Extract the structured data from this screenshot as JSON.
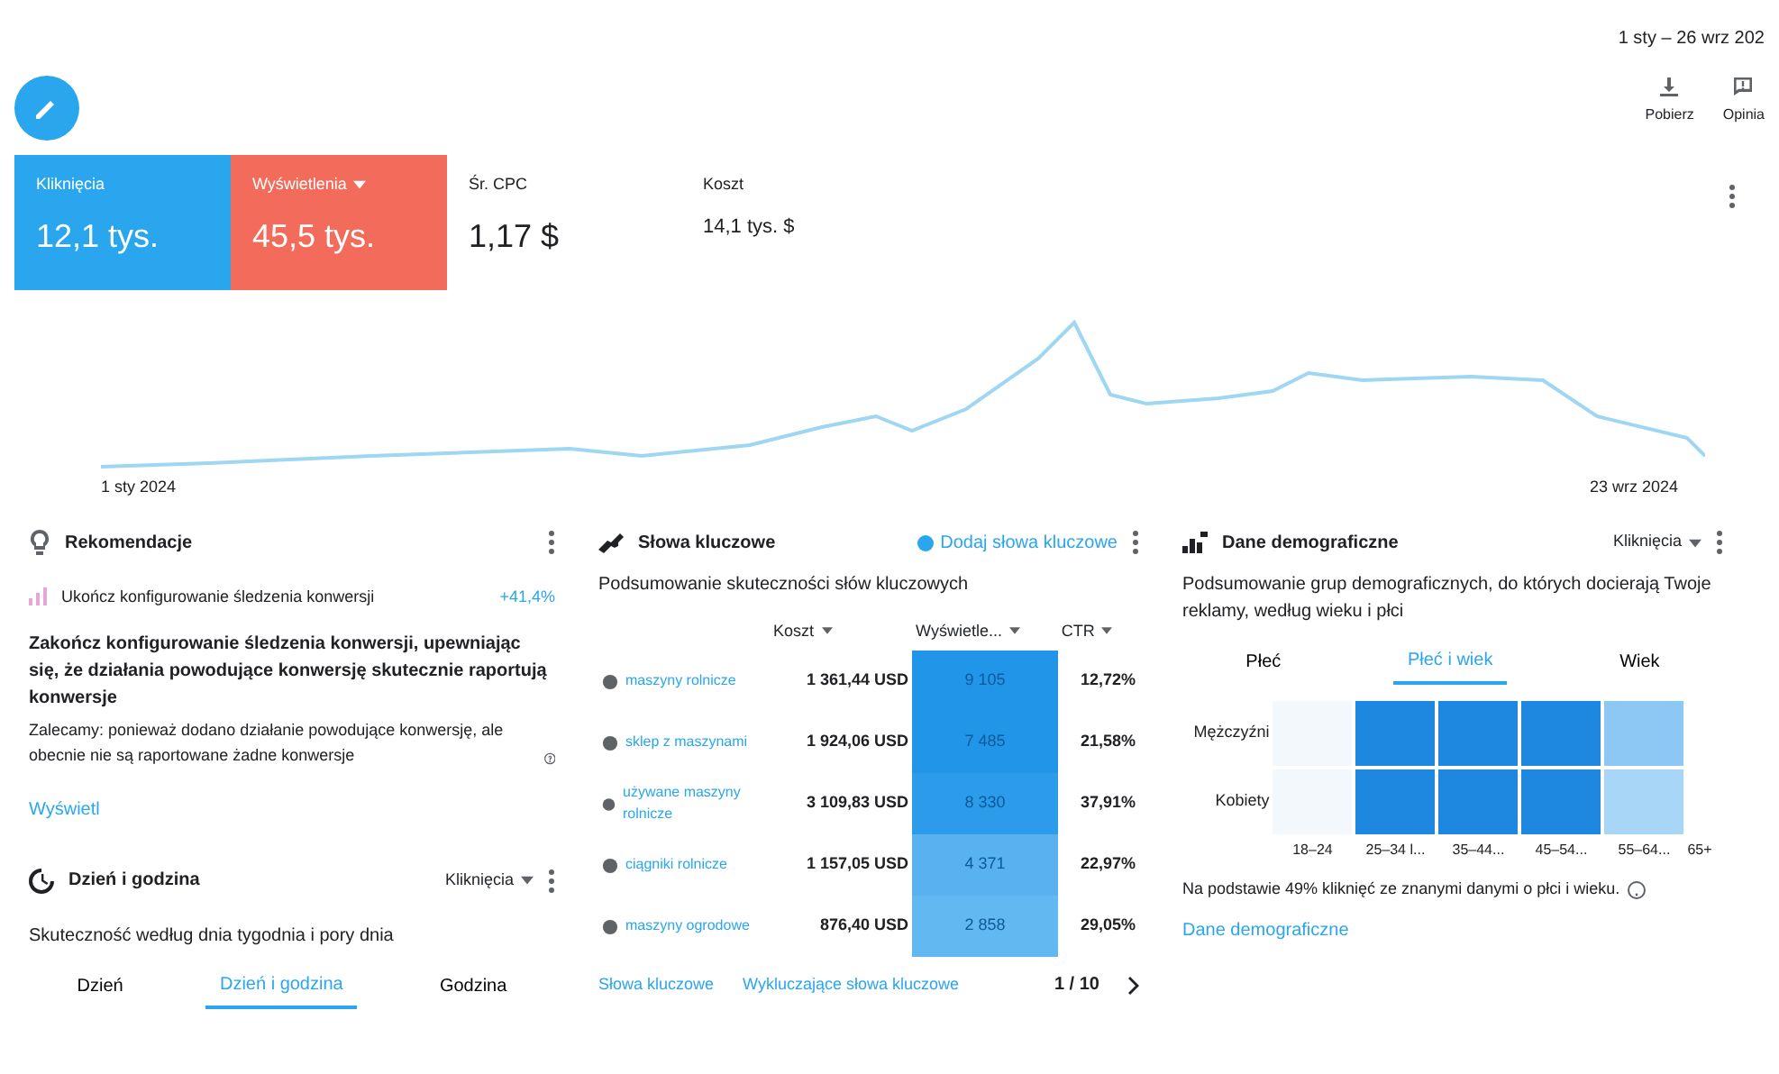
{
  "date_range": "1 sty – 26 wrz 202",
  "actions": [
    {
      "label": "Pobierz",
      "kind": "download"
    },
    {
      "label": "Opinia",
      "kind": "feedback"
    }
  ],
  "metrics": [
    {
      "label": "Kliknięcia",
      "value": "12,1 tys.",
      "color": "#2aa6ee",
      "dropdown": false
    },
    {
      "label": "Wyświetlenia",
      "value": "45,5 tys.",
      "color": "#f26b5b",
      "dropdown": true
    },
    {
      "label": "Śr. CPC",
      "value": "1,17 $",
      "dropdown": false
    },
    {
      "label": "Koszt",
      "value": "14,1 tys. $",
      "dropdown": false
    }
  ],
  "trend": {
    "start_label": "1 sty 2024",
    "end_label": "23 wrz 2024"
  },
  "recommendations": {
    "title": "Rekomendacje",
    "item": "Ukończ konfigurowanie śledzenia konwersji",
    "uplift": "+41,4%",
    "headline": "Zakończ konfigurowanie śledzenia konwersji, upewniając się, że działania powodujące konwersję skutecznie raportują konwersje",
    "detail": "Zalecamy: ponieważ dodano działanie powodujące konwersję, ale obecnie nie są raportowane żadne konwersje",
    "link": "Wyświetl"
  },
  "day_hour": {
    "title": "Dzień i godzina",
    "metric": "Kliknięcia",
    "subtitle": "Skuteczność według dnia tygodnia i pory dnia",
    "tabs": [
      {
        "label": "Dzień",
        "selected": false
      },
      {
        "label": "Dzień i godzina",
        "selected": true
      },
      {
        "label": "Godzina",
        "selected": false
      }
    ]
  },
  "keywords": {
    "title": "Słowa kluczowe",
    "add": "Dodaj słowa kluczowe",
    "subtitle": "Podsumowanie skuteczności słów kluczowych",
    "columns": [
      "Koszt",
      "Wyświetle...",
      "CTR"
    ],
    "rows": [
      {
        "keyword": "maszyny rolnicze",
        "cost": "1 361,44 USD",
        "impressions": "9 105",
        "color": "#2196e8",
        "ctr": "12,72%"
      },
      {
        "keyword": "sklep z maszynami",
        "cost": "1 924,06 USD",
        "impressions": "7 485",
        "color": "#2196e8",
        "ctr": "21,58%"
      },
      {
        "keyword": "używane maszyny rolnicze",
        "cost": "3 109,83 USD",
        "impressions": "8 330",
        "color": "#2c9be9",
        "ctr": "37,91%"
      },
      {
        "keyword": "ciągniki rolnicze",
        "cost": "1 157,05 USD",
        "impressions": "4 371",
        "color": "#58b2ef",
        "ctr": "22,97%"
      },
      {
        "keyword": "maszyny ogrodowe",
        "cost": "876,40 USD",
        "impressions": "2 858",
        "color": "#62b8f0",
        "ctr": "29,05%"
      }
    ],
    "links": [
      "Słowa kluczowe",
      "Wykluczające słowa kluczowe"
    ],
    "page": "1 / 10"
  },
  "demographics": {
    "title": "Dane demograficzne",
    "metric": "Kliknięcia",
    "subtitle": "Podsumowanie grup demograficznych, do których docierają Twoje reklamy, według wieku i płci",
    "tabs": [
      {
        "label": "Płeć",
        "selected": false
      },
      {
        "label": "Płeć i wiek",
        "selected": true
      },
      {
        "label": "Wiek",
        "selected": false
      }
    ],
    "ages": [
      "18–24",
      "25–34 l...",
      "35–44...",
      "45–54...",
      "55–64...",
      "65+"
    ],
    "rows": [
      {
        "label": "Mężczyźni",
        "cells": [
          {
            "color": "#f3f8fd"
          },
          {
            "color": "#1e88e0"
          },
          {
            "color": "#1e88e0"
          },
          {
            "color": "#1e88e0"
          },
          {
            "color": "#8cc8f3"
          }
        ]
      },
      {
        "label": "Kobiety",
        "cells": [
          {
            "color": "#f3f8fd"
          },
          {
            "color": "#1e88e0"
          },
          {
            "color": "#1e88e0"
          },
          {
            "color": "#1e88e0"
          },
          {
            "color": "#a8d6f6"
          }
        ]
      }
    ],
    "note": "Na podstawie 49% kliknięć ze znanymi danymi o płci i wieku.",
    "link": "Dane demograficzne"
  }
}
